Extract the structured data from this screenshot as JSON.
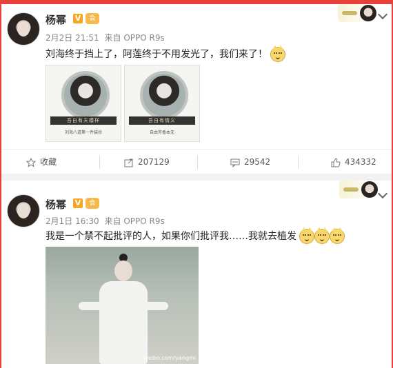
{
  "posts": [
    {
      "author": "杨幂",
      "verified_badge": "V",
      "member_icon": "会",
      "timestamp": "2月2日 21:51",
      "source": "来自 OPPO R9s",
      "text": "刘海终于挡上了，阿莲终于不用发光了，我们来了！",
      "emoji_count": 1,
      "images": [
        {
          "banner": "吾自有天模样",
          "caption": "刘海八道第一件装扮"
        },
        {
          "banner": "吾自有情义",
          "caption": "自由芳香本无"
        }
      ],
      "actions": {
        "favorite_label": "收藏",
        "repost_count": "207129",
        "comment_count": "29542",
        "like_count": "434332"
      }
    },
    {
      "author": "杨幂",
      "verified_badge": "V",
      "member_icon": "会",
      "timestamp": "2月1日 16:30",
      "source": "来自 OPPO R9s",
      "text": "我是一个禁不起批评的人，如果你们批评我……我就去植发",
      "emoji_count": 3,
      "photo_watermark": "weibo.com/yangmi"
    }
  ],
  "icons": [
    "star-icon",
    "repost-icon",
    "comment-icon",
    "like-icon",
    "chevron-down-icon"
  ],
  "colors": {
    "frame": "#e8413b",
    "badge": "#f6a623"
  }
}
